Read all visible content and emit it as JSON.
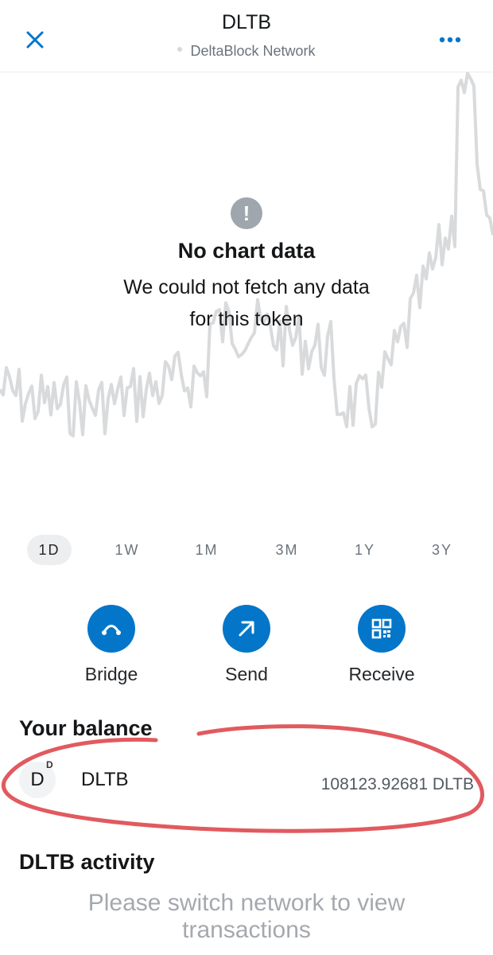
{
  "header": {
    "title": "DLTB",
    "network": "DeltaBlock Network"
  },
  "icons": {
    "close": "close-icon",
    "more": "more-horizontal-icon",
    "warning": "exclamation-icon",
    "bridge": "bridge-icon",
    "send": "arrow-up-right-icon",
    "receive": "qr-code-icon"
  },
  "chart": {
    "warning_glyph": "!",
    "headline": "No chart data",
    "message": "We could not fetch any data for this token"
  },
  "ranges": [
    {
      "label": "1D",
      "active": true
    },
    {
      "label": "1W",
      "active": false
    },
    {
      "label": "1M",
      "active": false
    },
    {
      "label": "3M",
      "active": false
    },
    {
      "label": "1Y",
      "active": false
    },
    {
      "label": "3Y",
      "active": false
    }
  ],
  "actions": {
    "bridge": "Bridge",
    "send": "Send",
    "receive": "Receive"
  },
  "balance": {
    "title": "Your balance",
    "asset_letter": "D",
    "asset_badge": "D",
    "asset_name": "DLTB",
    "amount": "108123.92681 DLTB"
  },
  "activity": {
    "title": "DLTB activity",
    "message": "Please switch network to view transactions"
  },
  "colors": {
    "accent": "#0376c9",
    "annotation": "#e15a5f",
    "placeholder_line": "#d8dadc"
  }
}
